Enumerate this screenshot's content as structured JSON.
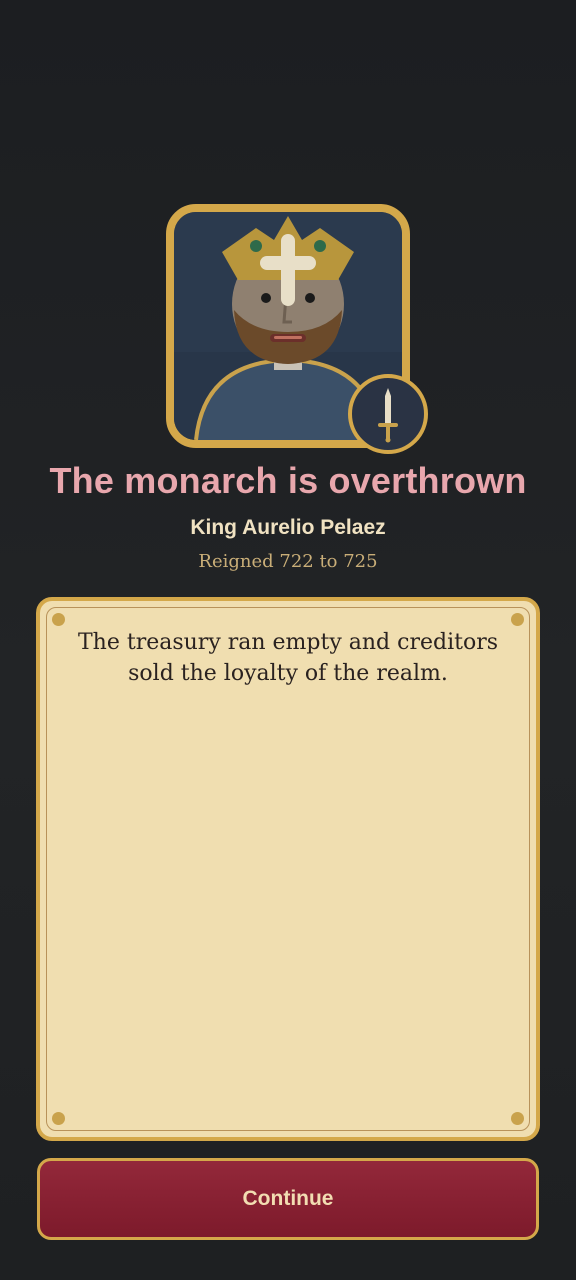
{
  "header": {
    "title": "The monarch is overthrown",
    "king_name": "King Aurelio Pelaez",
    "reign": "Reigned 722 to 725"
  },
  "story": {
    "text": "The treasury ran empty and creditors sold the loyalty of the realm."
  },
  "actions": {
    "continue_label": "Continue"
  },
  "icons": {
    "portrait": "king-portrait-icon",
    "badge": "sword-icon"
  },
  "colors": {
    "background": "#1e2022",
    "gold": "#d4a84a",
    "title_pink": "#e8a7ad",
    "parchment": "#f0deb0",
    "button_red": "#8a2233"
  }
}
